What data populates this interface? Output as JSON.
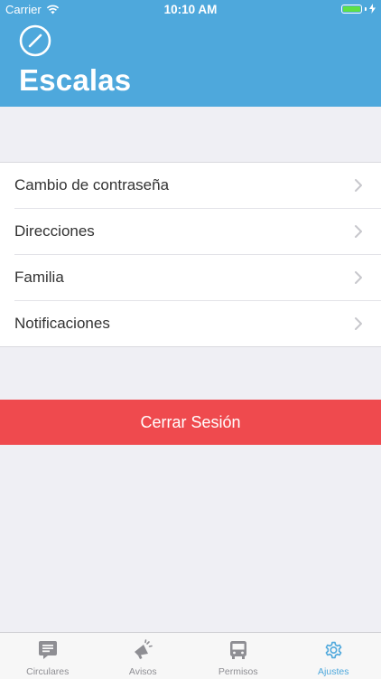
{
  "status_bar": {
    "carrier": "Carrier",
    "time": "10:10 AM",
    "battery_level": 1.0
  },
  "header": {
    "title": "Escalas",
    "icon": "compass-icon"
  },
  "settings": {
    "items": [
      {
        "label": "Cambio de contraseña",
        "icon": "chevron-right-icon"
      },
      {
        "label": "Direcciones",
        "icon": "chevron-right-icon"
      },
      {
        "label": "Familia",
        "icon": "chevron-right-icon"
      },
      {
        "label": "Notificaciones",
        "icon": "chevron-right-icon"
      }
    ]
  },
  "logout": {
    "label": "Cerrar Sesión"
  },
  "tabs": [
    {
      "label": "Circulares",
      "icon": "message-icon",
      "active": false
    },
    {
      "label": "Avisos",
      "icon": "megaphone-icon",
      "active": false
    },
    {
      "label": "Permisos",
      "icon": "bus-icon",
      "active": false
    },
    {
      "label": "Ajustes",
      "icon": "gear-icon",
      "active": true
    }
  ],
  "colors": {
    "header": "#4ea8dc",
    "background": "#efeff4",
    "danger": "#ef4a4e",
    "tab_active": "#4ea8dc",
    "tab_inactive": "#8e8e93",
    "battery": "#5ee045"
  }
}
